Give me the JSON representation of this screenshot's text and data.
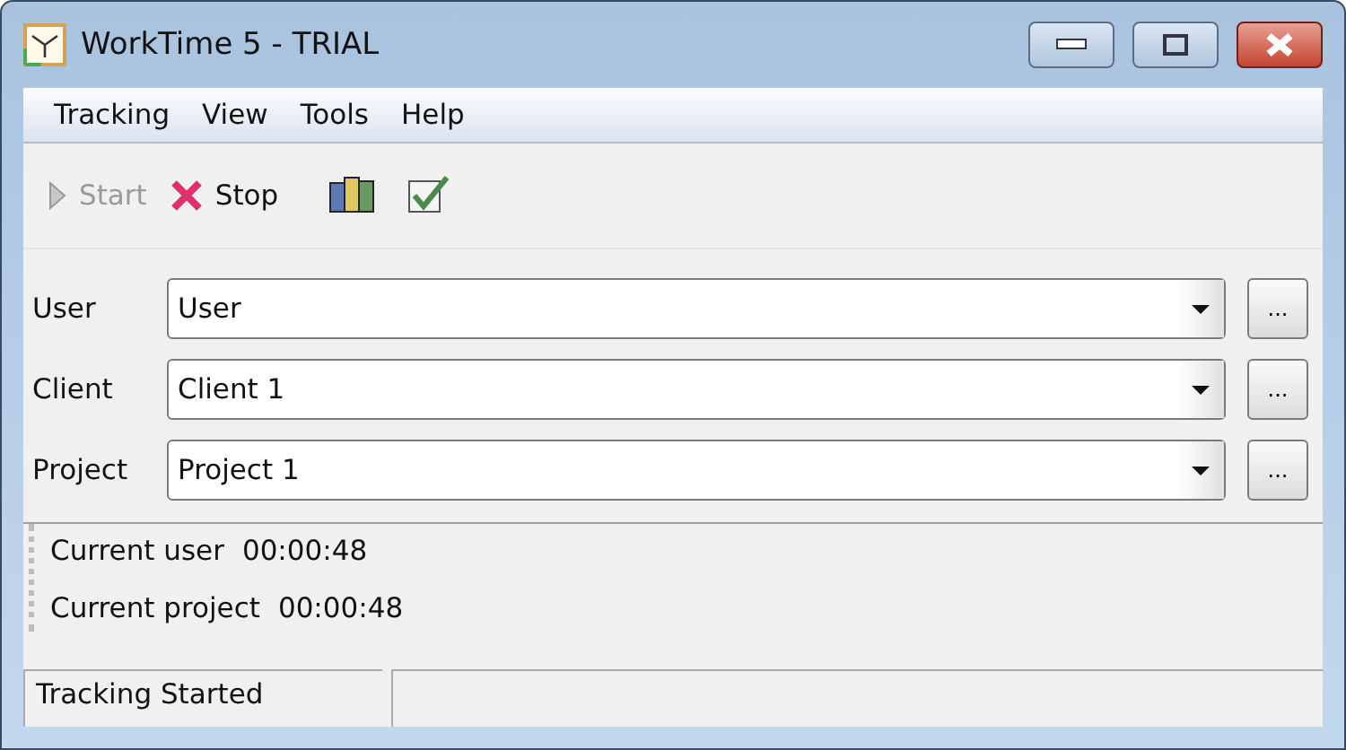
{
  "window": {
    "title": "WorkTime 5 - TRIAL"
  },
  "menu": [
    "Tracking",
    "View",
    "Tools",
    "Help"
  ],
  "toolbar": [
    {
      "kind": "start",
      "label": "Start",
      "disabled": true
    },
    {
      "kind": "stop",
      "label": "Stop",
      "disabled": false
    },
    {
      "kind": "books"
    },
    {
      "kind": "check"
    }
  ],
  "fields": [
    {
      "label": "User",
      "value": "User",
      "button": "..."
    },
    {
      "label": "Client",
      "value": "Client 1",
      "button": "..."
    },
    {
      "label": "Project",
      "value": "Project 1",
      "button": "..."
    }
  ],
  "timers": [
    {
      "label": "Current user",
      "time": "00:00:48"
    },
    {
      "label": "Current project",
      "time": "00:00:48"
    }
  ],
  "status_bar": [
    "Tracking Started"
  ]
}
